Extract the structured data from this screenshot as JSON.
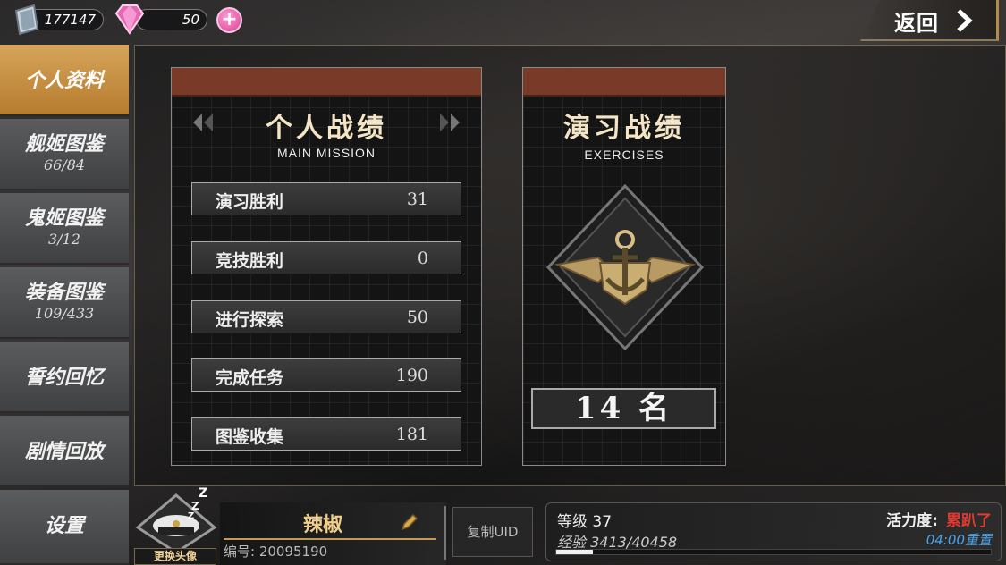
{
  "resources": {
    "steel_value": "177147",
    "gem_value": "50"
  },
  "back": {
    "label": "返回"
  },
  "sidebar": {
    "items": [
      {
        "label": "个人资料",
        "sub": "",
        "active": true
      },
      {
        "label": "舰姬图鉴",
        "sub": "66/84"
      },
      {
        "label": "鬼姬图鉴",
        "sub": "3/12"
      },
      {
        "label": "装备图鉴",
        "sub": "109/433"
      },
      {
        "label": "誓约回忆",
        "sub": ""
      },
      {
        "label": "剧情回放",
        "sub": ""
      },
      {
        "label": "设置",
        "sub": ""
      }
    ]
  },
  "personal": {
    "title": "个人战绩",
    "subtitle": "MAIN MISSION",
    "stats": [
      {
        "label": "演习胜利",
        "value": "31"
      },
      {
        "label": "竞技胜利",
        "value": "0"
      },
      {
        "label": "进行探索",
        "value": "50"
      },
      {
        "label": "完成任务",
        "value": "190"
      },
      {
        "label": "图鉴收集",
        "value": "181"
      }
    ]
  },
  "exercises": {
    "title": "演习战绩",
    "subtitle": "EXERCISES",
    "rank": "14 名"
  },
  "profile": {
    "avatar_change": "更换头像",
    "name": "辣椒",
    "uid": "编号: 20095190",
    "copy_uid": "复制UID",
    "level": "等级 37",
    "exp": "经验 3413/40458",
    "exp_fraction": 0.084,
    "vitality_label": "活力度:",
    "vitality_value": "累趴了",
    "reset": "04:00重置"
  },
  "colors": {
    "accent_gold": "#c49b54",
    "panel_header": "#7a3a28",
    "active_tab": "#d6a55a",
    "vitality_red": "#e23a2e",
    "reset_blue": "#4aa3e8"
  }
}
